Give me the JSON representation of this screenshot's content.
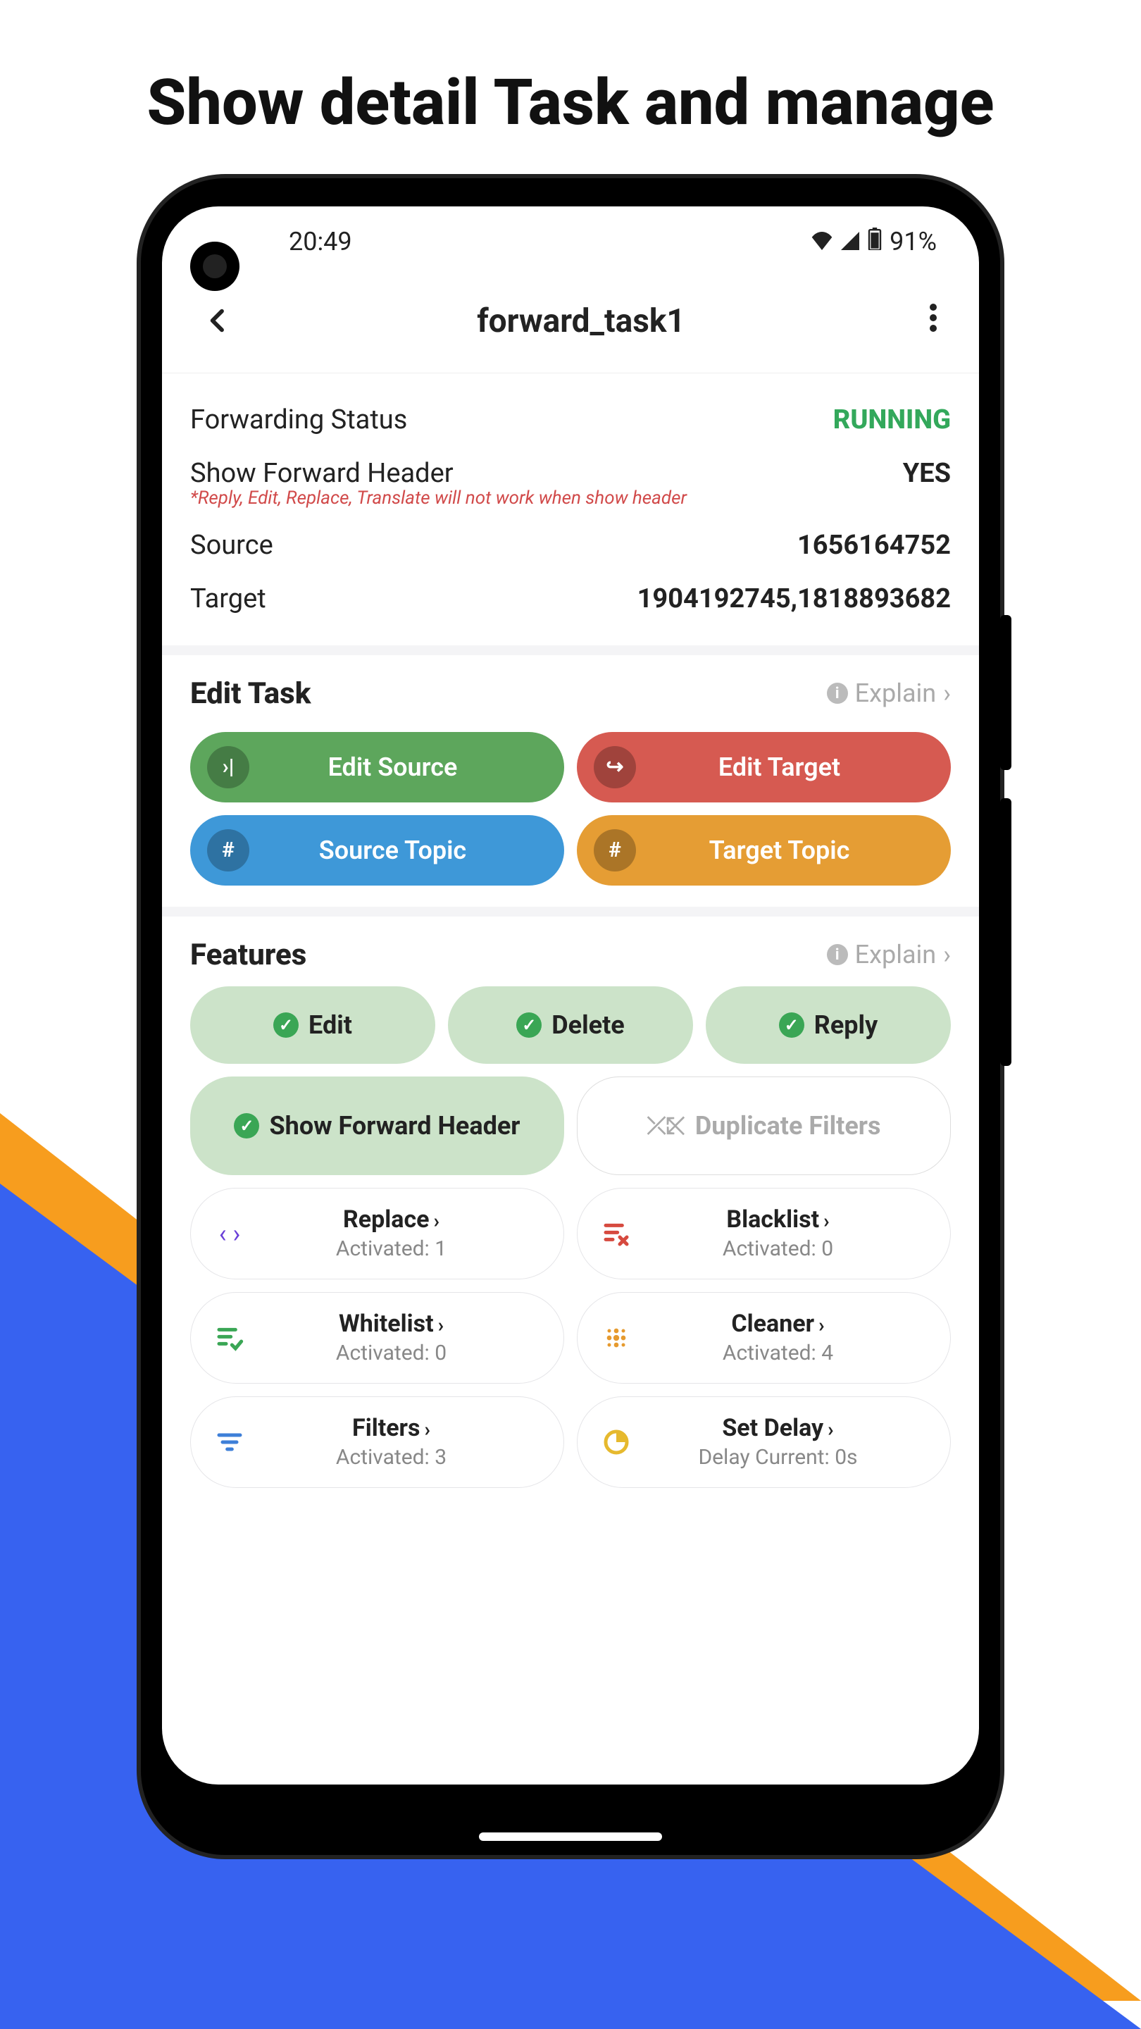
{
  "promo_title": "Show detail Task and manage",
  "status_bar": {
    "time": "20:49",
    "battery": "91%"
  },
  "header": {
    "title": "forward_task1"
  },
  "info": {
    "forwarding_label": "Forwarding Status",
    "forwarding_value": "RUNNING",
    "header_label": "Show Forward Header",
    "header_value": "YES",
    "header_note": "*Reply, Edit, Replace, Translate will not work when show header",
    "source_label": "Source",
    "source_value": "1656164752",
    "target_label": "Target",
    "target_value": "1904192745,1818893682"
  },
  "edit_task": {
    "title": "Edit Task",
    "explain": "Explain",
    "edit_source": "Edit Source",
    "edit_target": "Edit Target",
    "source_topic": "Source Topic",
    "target_topic": "Target Topic"
  },
  "features": {
    "title": "Features",
    "explain": "Explain",
    "edit": "Edit",
    "delete": "Delete",
    "reply": "Reply",
    "show_header": "Show Forward Header",
    "duplicate": "Duplicate Filters",
    "replace": {
      "title": "Replace",
      "sub": "Activated: 1"
    },
    "blacklist": {
      "title": "Blacklist",
      "sub": "Activated: 0"
    },
    "whitelist": {
      "title": "Whitelist",
      "sub": "Activated: 0"
    },
    "cleaner": {
      "title": "Cleaner",
      "sub": "Activated: 4"
    },
    "filters": {
      "title": "Filters",
      "sub": "Activated: 3"
    },
    "delay": {
      "title": "Set Delay",
      "sub": "Delay Current: 0s"
    }
  }
}
